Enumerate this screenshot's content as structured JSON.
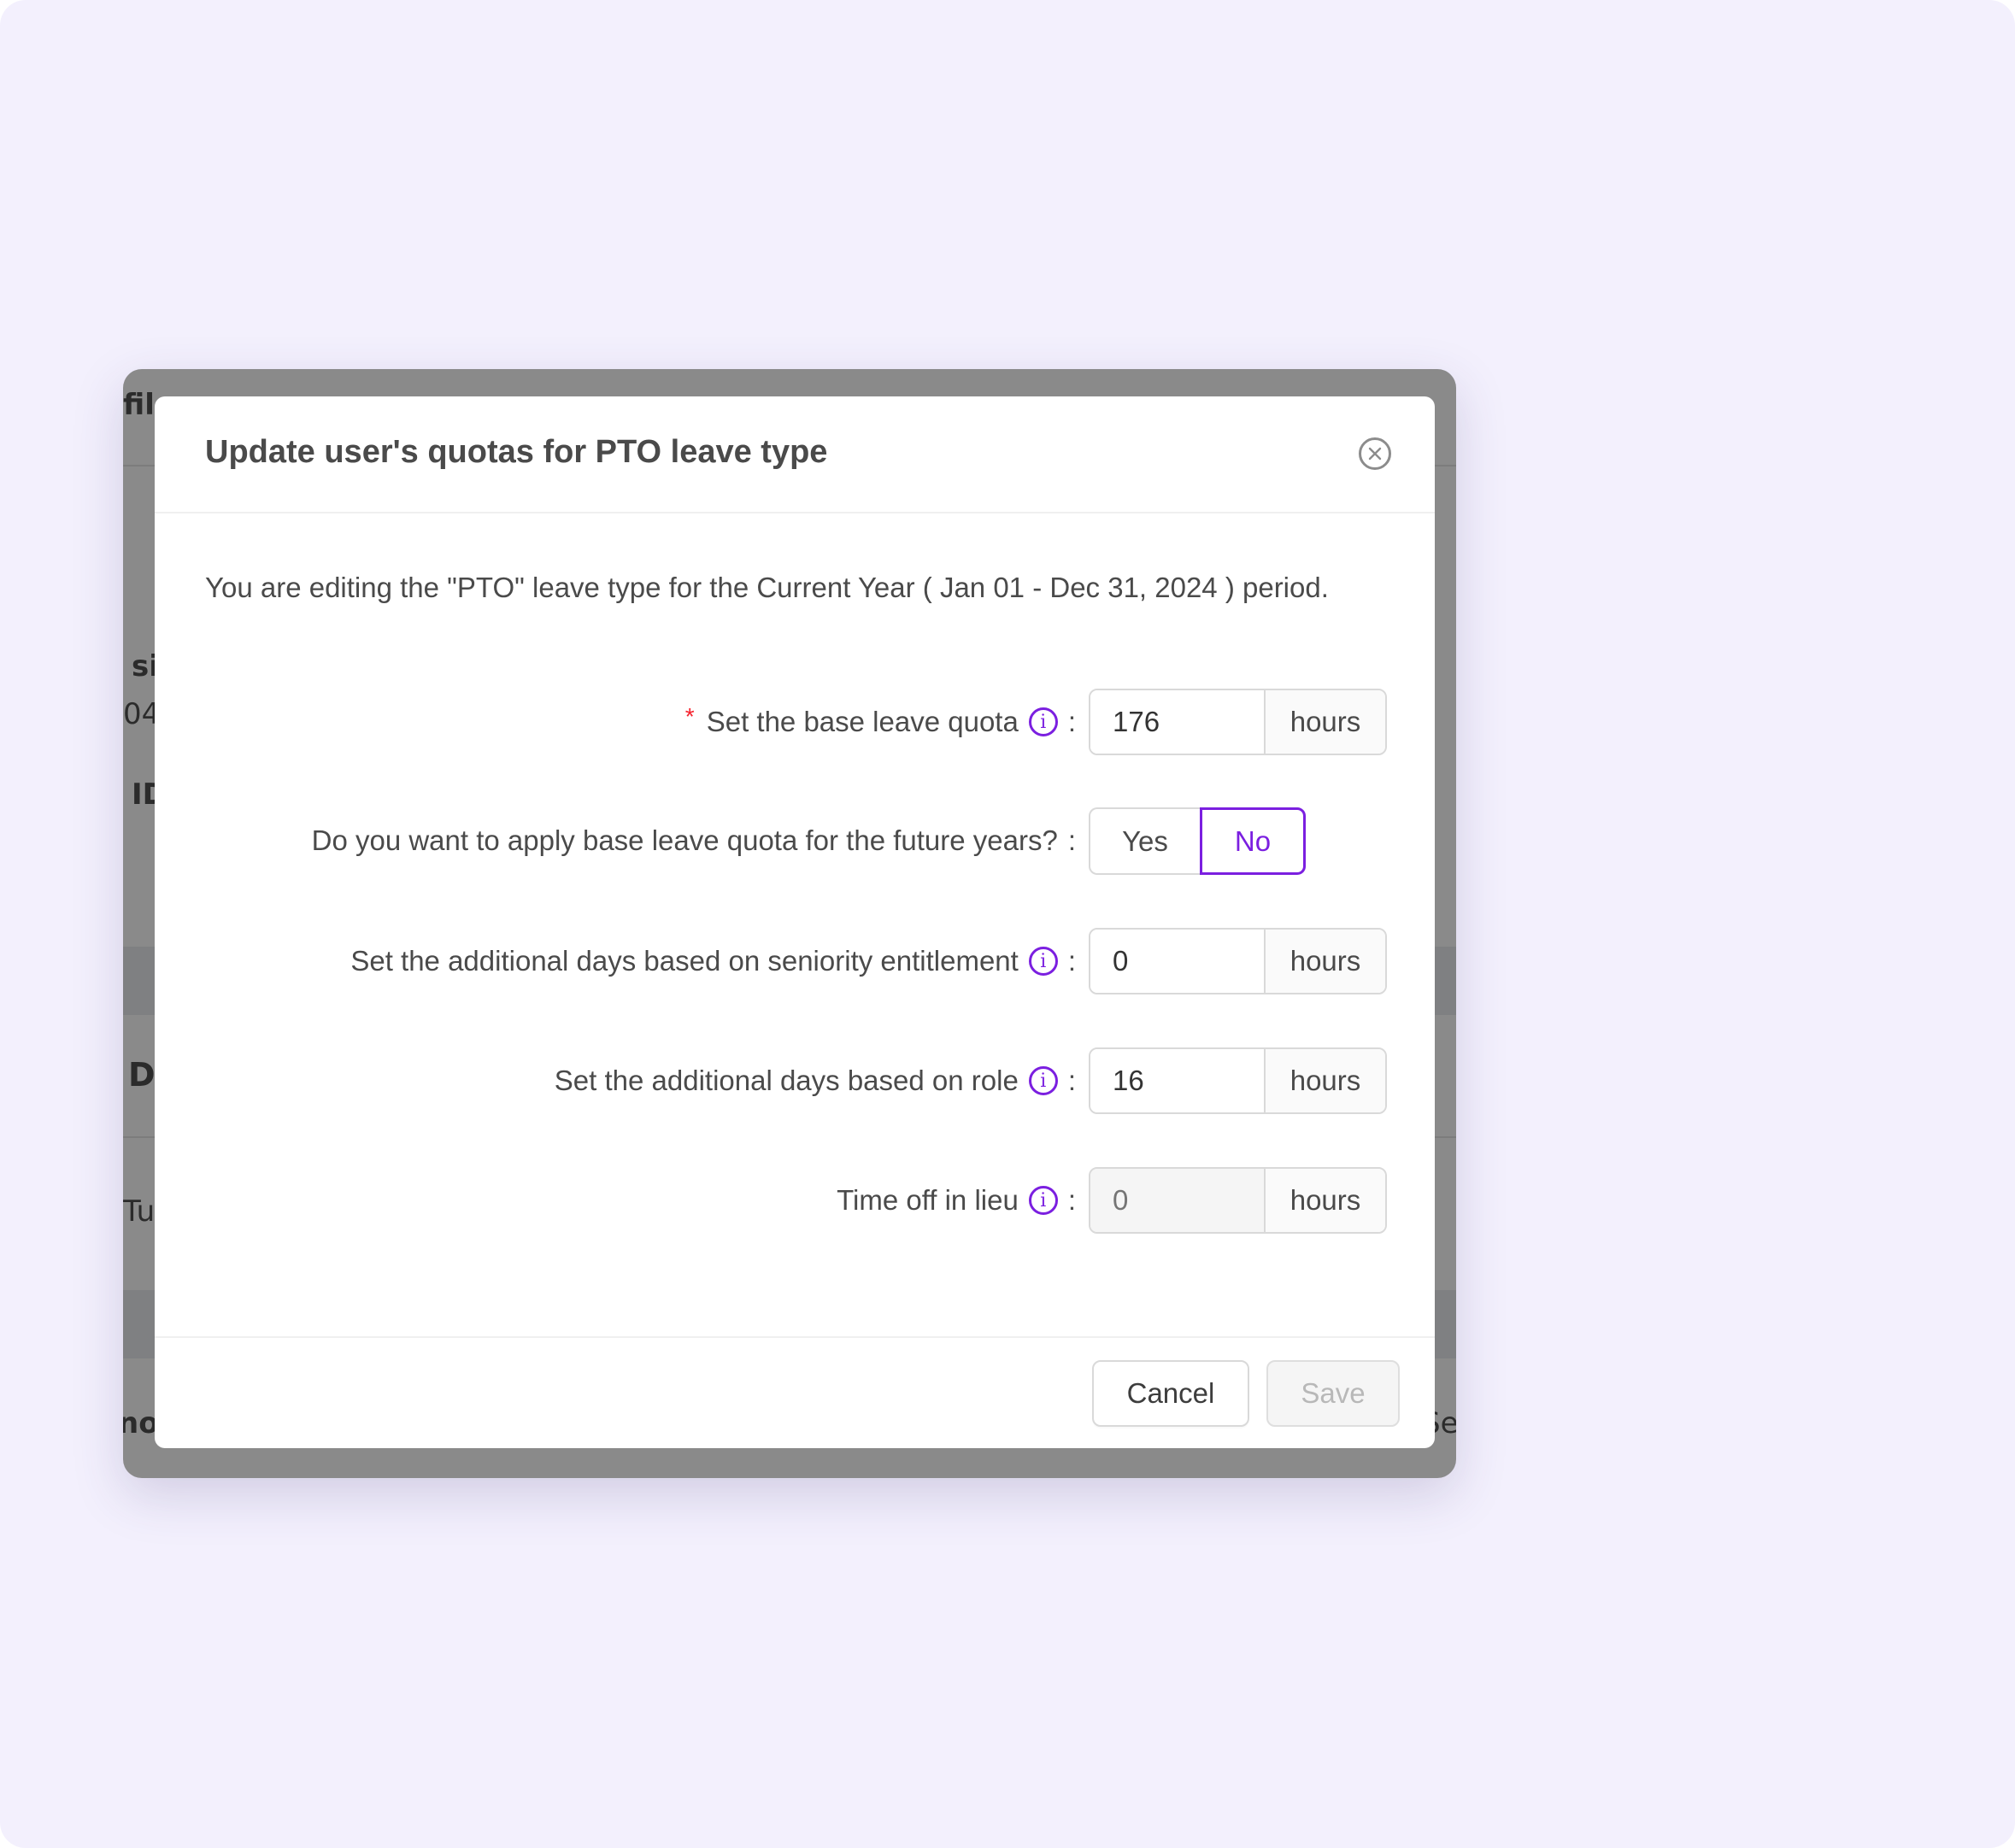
{
  "background": {
    "fragments": [
      "fil",
      "si",
      "04",
      "ID",
      "D",
      "Tue",
      "not",
      "Se"
    ]
  },
  "modal": {
    "title": "Update user's quotas for PTO leave type",
    "close_icon": "close-circle-icon",
    "description": "You are editing the \"PTO\" leave type for the Current Year ( Jan 01 - Dec 31, 2024 ) period.",
    "fields": {
      "base_quota": {
        "required_mark": "*",
        "label": "Set the base leave quota",
        "value": "176",
        "unit": "hours"
      },
      "apply_future": {
        "label": "Do you want to apply base leave quota for the future years?",
        "options": [
          "Yes",
          "No"
        ],
        "selected": "No"
      },
      "seniority": {
        "label": "Set the additional days based on seniority entitlement",
        "value": "0",
        "unit": "hours"
      },
      "role": {
        "label": "Set the additional days based on role",
        "value": "16",
        "unit": "hours"
      },
      "lieu": {
        "label": "Time off in lieu",
        "placeholder": "0",
        "unit": "hours",
        "disabled": true
      }
    },
    "colon": ":",
    "info_icon_glyph": "i",
    "footer": {
      "cancel_label": "Cancel",
      "save_label": "Save"
    }
  },
  "colors": {
    "accent": "#7b1fe0",
    "required": "#f5222d",
    "page_background": "#f3f0fd"
  }
}
